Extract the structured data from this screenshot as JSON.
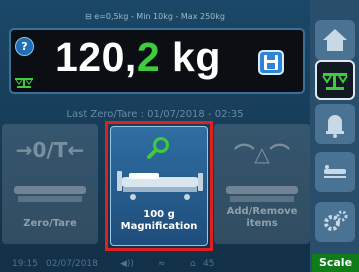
{
  "header": {
    "spec_text": "e=0,5kg - Min 10kg - Max 250kg"
  },
  "weight": {
    "integer": "120,",
    "decimal": "2",
    "unit": " kg"
  },
  "last_zero": "Last Zero/Tare : 01/07/2018 - 02:35",
  "tiles": {
    "zero_tare": {
      "symbol": "→0/T←",
      "label": "Zero/Tare"
    },
    "magnification": {
      "line1": "100 g",
      "line2": "Magnification"
    },
    "add_remove": {
      "symbol": "⌒△⌒",
      "line1": "Add/Remove",
      "line2": "items"
    }
  },
  "status": {
    "time": "19:15",
    "date": "02/07/2018",
    "angle": "45"
  },
  "sidebar": {
    "active_tab_label": "Scale"
  },
  "colors": {
    "accent_green": "#3ecb3e",
    "highlight_red": "#e02020",
    "panel_blue": "#1e4d7a"
  }
}
